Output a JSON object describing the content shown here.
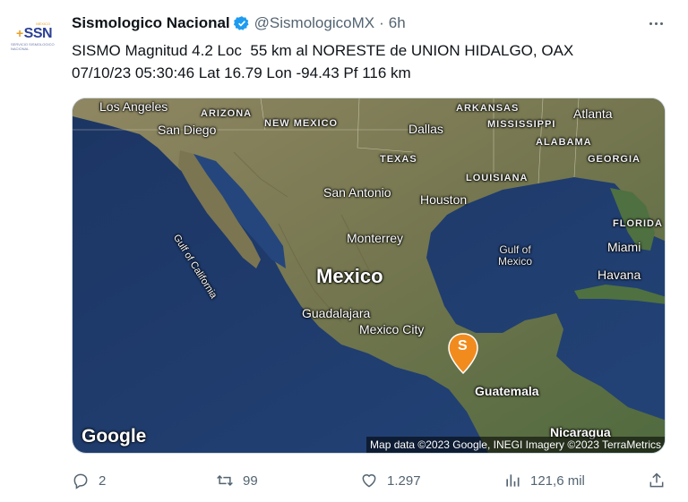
{
  "avatar": {
    "logo_text": "SSN",
    "logo_subtext": "SERVICIO SISMOLOGICO NACIONAL",
    "logo_top": "MEXICO"
  },
  "tweet": {
    "name": "Sismologico Nacional",
    "handle": "@SismologicoMX",
    "separator": "·",
    "time": "6h",
    "lines": [
      "SISMO Magnitud 4.2 Loc  55 km al NORESTE de UNION HIDALGO, OAX",
      "07/10/23 05:30:46 Lat 16.79 Lon -94.43 Pf 116 km"
    ]
  },
  "map": {
    "labels": {
      "los_angeles": "Los Angeles",
      "san_diego": "San Diego",
      "arizona": "ARIZONA",
      "new_mexico": "NEW MEXICO",
      "arkansas": "ARKANSAS",
      "mississippi": "MISSISSIPPI",
      "atlanta": "Atlanta",
      "alabama": "ALABAMA",
      "georgia": "GEORGIA",
      "dallas": "Dallas",
      "texas": "TEXAS",
      "louisiana": "LOUISIANA",
      "san_antonio": "San Antonio",
      "houston": "Houston",
      "florida": "FLORIDA",
      "miami": "Miami",
      "gulf_california": "Gulf of California",
      "gulf_mexico_1": "Gulf of",
      "gulf_mexico_2": "Mexico",
      "monterrey": "Monterrey",
      "mexico": "Mexico",
      "havana": "Havana",
      "guadalajara": "Guadalajara",
      "mexico_city": "Mexico City",
      "guatemala": "Guatemala",
      "nicaragua": "Nicaragua"
    },
    "pin_letter": "S",
    "google": "Google",
    "attribution": "Map data ©2023 Google, INEGI Imagery ©2023 TerraMetrics",
    "colors": {
      "land": "#7d7a5a",
      "ocean": "#1f3b6e",
      "pin": "#f28b1e"
    }
  },
  "actions": {
    "replies": "2",
    "reposts": "99",
    "likes": "1.297",
    "views": "121,6 mil",
    "icons": [
      "reply-icon",
      "repost-icon",
      "like-icon",
      "views-icon",
      "share-icon"
    ]
  }
}
